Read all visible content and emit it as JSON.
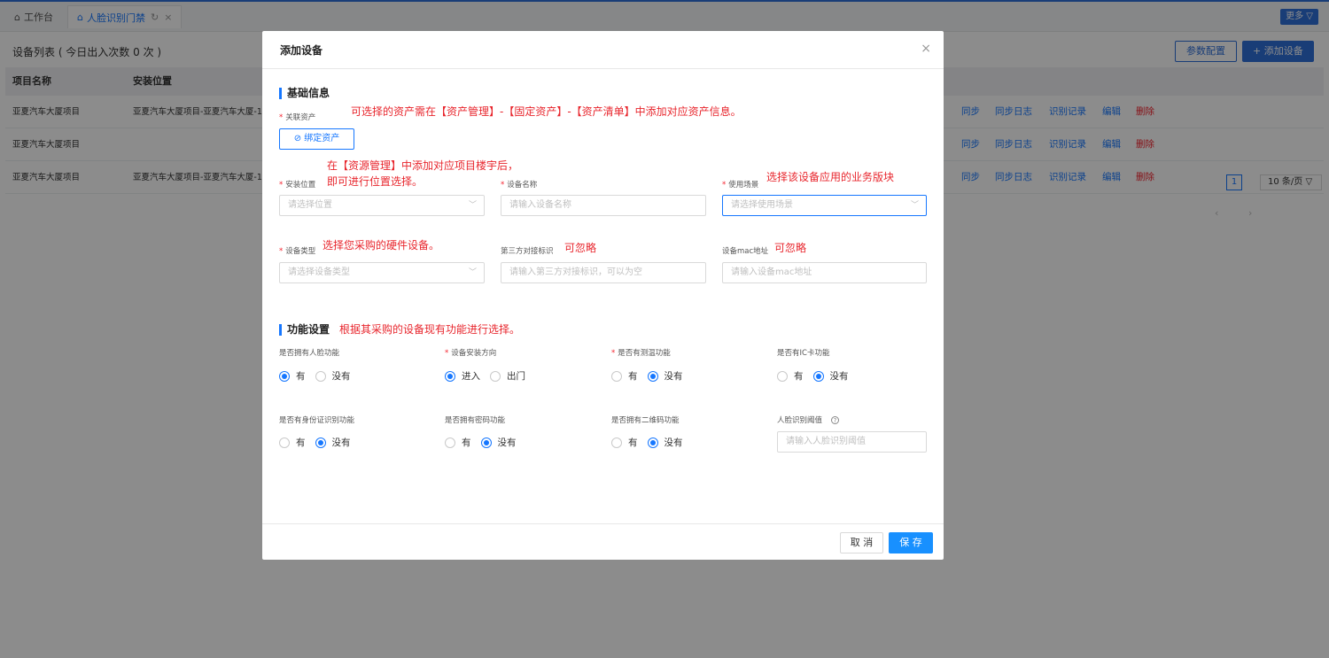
{
  "tabs": [
    {
      "icon": "⌂",
      "label": "工作台"
    },
    {
      "icon": "⌂",
      "label": "人脸识别门禁"
    }
  ],
  "topbar": {
    "more_label": "更多 ▽"
  },
  "page": {
    "title": "设备列表 ( 今日出入次数 0 次 )",
    "param_button": "参数配置",
    "add_button": "+ 添加设备",
    "columns": [
      "项目名称",
      "安装位置"
    ],
    "rows": [
      {
        "project": "亚夏汽车大厦项目",
        "location": "亚夏汽车大厦项目-亚夏汽车大厦-1"
      },
      {
        "project": "亚夏汽车大厦项目",
        "location": ""
      },
      {
        "project": "亚夏汽车大厦项目",
        "location": "亚夏汽车大厦项目-亚夏汽车大厦-1"
      }
    ],
    "row_actions": [
      "同步",
      "同步日志",
      "识别记录",
      "编辑",
      "删除"
    ],
    "pager": {
      "current": "1",
      "page_size": "10 条/页 ▽"
    }
  },
  "modal": {
    "title": "添加设备",
    "close": "×",
    "basic_section": "基础信息",
    "func_section": "功能设置",
    "asset_label": "关联资产",
    "bind_asset_button": "⊘ 绑定资产",
    "fields": {
      "location": {
        "label": "安装位置",
        "placeholder": "请选择位置"
      },
      "device_name": {
        "label": "设备名称",
        "placeholder": "请输入设备名称"
      },
      "scene": {
        "label": "使用场景",
        "placeholder": "请选择使用场景"
      },
      "device_type": {
        "label": "设备类型",
        "placeholder": "请选择设备类型"
      },
      "third_party": {
        "label": "第三方对接标识",
        "placeholder": "请输入第三方对接标识，可以为空"
      },
      "mac": {
        "label": "设备mac地址",
        "placeholder": "请输入设备mac地址"
      },
      "threshold": {
        "label": "人脸识别阈值",
        "placeholder": "请输入人脸识别阈值"
      }
    },
    "radios": [
      {
        "label": "是否拥有人脸功能",
        "required": false,
        "options": [
          "有",
          "没有"
        ],
        "selected": 0
      },
      {
        "label": "设备安装方向",
        "required": true,
        "options": [
          "进入",
          "出门"
        ],
        "selected": 0
      },
      {
        "label": "是否有测温功能",
        "required": true,
        "options": [
          "有",
          "没有"
        ],
        "selected": 1
      },
      {
        "label": "是否有IC卡功能",
        "required": false,
        "options": [
          "有",
          "没有"
        ],
        "selected": 1
      },
      {
        "label": "是否有身份证识别功能",
        "required": false,
        "options": [
          "有",
          "没有"
        ],
        "selected": 1
      },
      {
        "label": "是否拥有密码功能",
        "required": false,
        "options": [
          "有",
          "没有"
        ],
        "selected": 1
      },
      {
        "label": "是否拥有二维码功能",
        "required": false,
        "options": [
          "有",
          "没有"
        ],
        "selected": 1
      }
    ],
    "cancel_button": "取 消",
    "save_button": "保 存"
  },
  "annotations": {
    "asset": "可选择的资产需在【资产管理】-【固定资产】-【资产清单】中添加对应资产信息。",
    "location_line1": "在【资源管理】中添加对应项目楼宇后，",
    "location_line2": "即可进行位置选择。",
    "scene": "选择该设备应用的业务版块",
    "device_type": "选择您采购的硬件设备。",
    "third_party": "可忽略",
    "mac": "可忽略",
    "func": "根据其采购的设备现有功能进行选择。"
  },
  "colors": {
    "accent": "#1677ff",
    "annotation": "#e8262d",
    "danger": "#f5222d"
  }
}
